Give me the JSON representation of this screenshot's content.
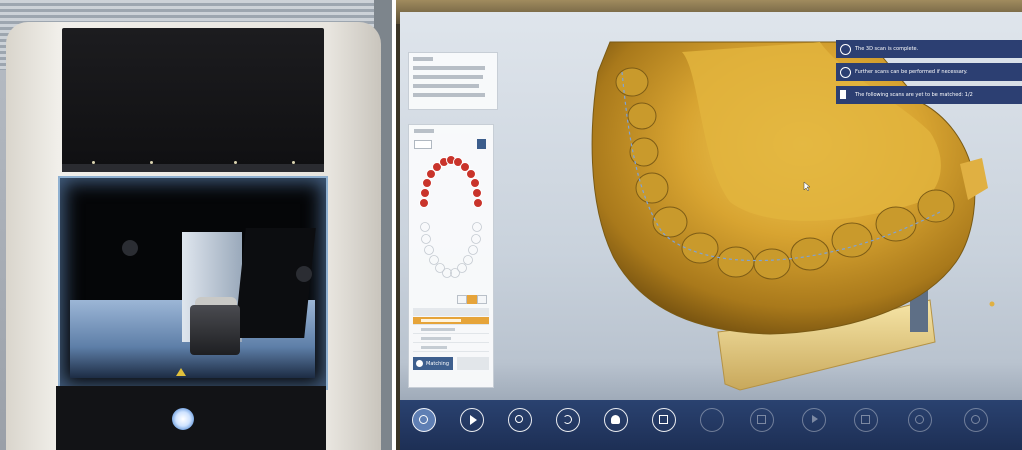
{
  "left_photo": {
    "description": "dental lab scanner with open scanning chamber"
  },
  "info_panel": {
    "rows": [
      "",
      "",
      "",
      ""
    ]
  },
  "scan_panel": {
    "title": "",
    "dropdown_value": "",
    "scan_types": [
      "",
      "",
      "",
      ""
    ],
    "list_header": "",
    "list_items": [
      {
        "label": "",
        "selected": true
      },
      {
        "label": "",
        "selected": false
      },
      {
        "label": "",
        "selected": false
      },
      {
        "label": "",
        "selected": false
      }
    ],
    "matching_label": "Matching",
    "cancel_label": ""
  },
  "notifications": [
    {
      "icon": "thumbs-up-icon",
      "text": "The 3D scan is complete."
    },
    {
      "icon": "info-icon",
      "text": "Further scans can be performed if necessary."
    },
    {
      "icon": "next-icon",
      "text": "The following scans are yet to be matched: 1/2"
    }
  ],
  "toolbar": {
    "buttons": [
      {
        "icon": "scan-icon",
        "label": "",
        "state": "active"
      },
      {
        "icon": "play-icon",
        "label": "",
        "state": "normal"
      },
      {
        "icon": "search-icon",
        "label": "",
        "state": "normal"
      },
      {
        "icon": "undo-icon",
        "label": "",
        "state": "normal"
      },
      {
        "icon": "person-icon",
        "label": "",
        "state": "normal"
      },
      {
        "icon": "grid-icon",
        "label": "",
        "state": "normal"
      },
      {
        "icon": "blank-icon",
        "label": "",
        "state": "faded"
      },
      {
        "icon": "document-icon",
        "label": "",
        "state": "faded"
      },
      {
        "icon": "arrow-icon",
        "label": "",
        "state": "faded"
      },
      {
        "icon": "frame-icon",
        "label": "",
        "state": "faded"
      },
      {
        "icon": "refresh-icon",
        "label": "",
        "state": "faded"
      },
      {
        "icon": "exit-icon",
        "label": "",
        "state": "faded"
      }
    ]
  },
  "colors": {
    "model_gold": "#d4a634",
    "toolbar_blue": "#22375f",
    "notification_blue": "#2c3f72",
    "selection_orange": "#e6a43a"
  }
}
